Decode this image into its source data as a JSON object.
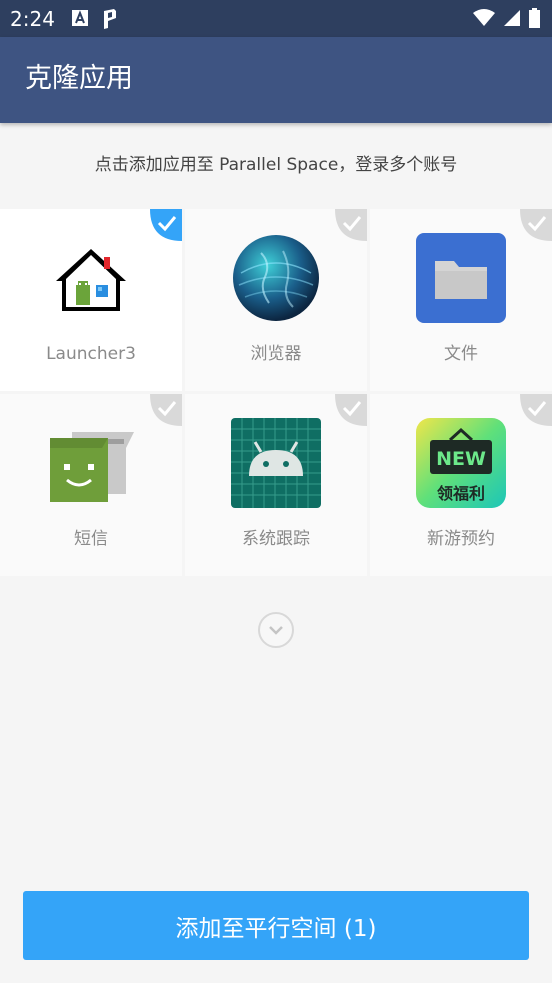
{
  "status_bar": {
    "time": "2:24",
    "left_icons": [
      "text-a-icon",
      "parallel-p-icon"
    ],
    "right_icons": [
      "wifi-icon",
      "signal-icon",
      "battery-icon"
    ]
  },
  "app_bar": {
    "title": "克隆应用"
  },
  "hint": {
    "text": "点击添加应用至 Parallel Space，登录多个账号"
  },
  "apps": [
    {
      "label": "Launcher3",
      "icon": "launcher-house-icon",
      "selected": true
    },
    {
      "label": "浏览器",
      "icon": "browser-globe-icon",
      "selected": false
    },
    {
      "label": "文件",
      "icon": "files-folder-icon",
      "selected": false
    },
    {
      "label": "短信",
      "icon": "messaging-icon",
      "selected": false
    },
    {
      "label": "系统跟踪",
      "icon": "system-tracing-android-icon",
      "selected": false
    },
    {
      "label": "新游预约",
      "icon": "new-game-icon",
      "selected": false,
      "badge_top": "NEW",
      "badge_bottom": "领福利"
    }
  ],
  "expand": {
    "icon": "chevron-down-icon"
  },
  "add_button": {
    "label": "添加至平行空间 (1)"
  },
  "colors": {
    "status_bar": "#2e3f5f",
    "app_bar": "#3e5482",
    "accent": "#34a4f8",
    "unselected_check": "#d9d9d9"
  }
}
